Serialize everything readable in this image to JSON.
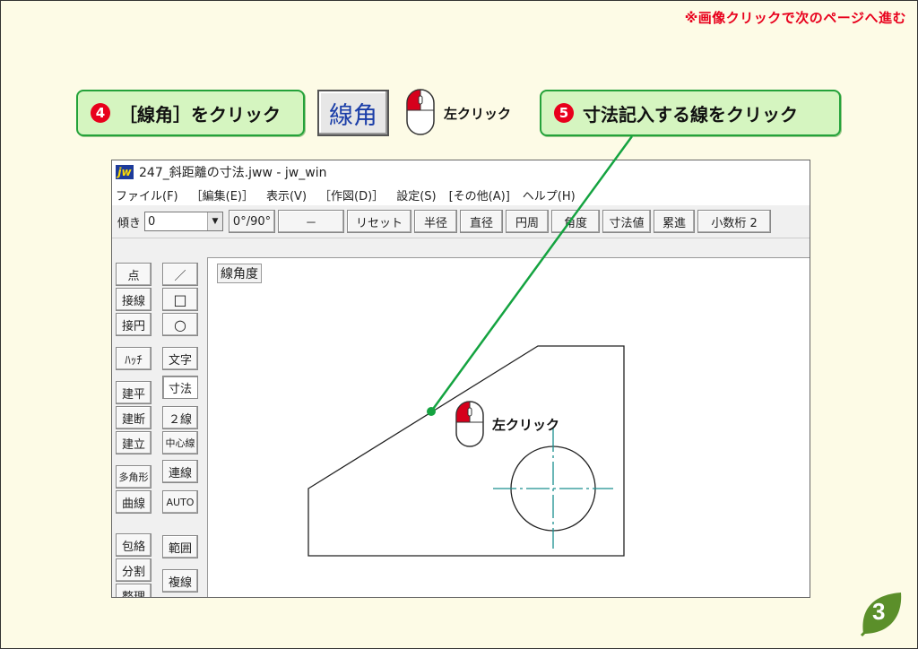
{
  "top_note": "※画像クリックで次のページへ進む",
  "step4": {
    "num": "4",
    "text": "［線角］をクリック"
  },
  "big_button_label": "線角",
  "left_click_1": "左クリック",
  "step5": {
    "num": "5",
    "text": "寸法記入する線をクリック"
  },
  "left_click_2": "左クリック",
  "window": {
    "title": "247_斜距離の寸法.jww - jw_win",
    "logo": "jw",
    "menu": [
      "ファイル(F)",
      "［編集(E)］",
      "表示(V)",
      "［作図(D)］",
      "設定(S)",
      "[その他(A)]",
      "ヘルプ(H)"
    ],
    "toolbar": {
      "tilt_label": "傾き",
      "tilt_value": "0",
      "buttons": [
        "0°/90°",
        "－",
        "リセット",
        "半径",
        "直径",
        "円周",
        "角度",
        "寸法値",
        "累進",
        "小数桁 2"
      ]
    },
    "left_col_1": [
      "点",
      "接線",
      "接円",
      "ﾊｯﾁ",
      "建平",
      "建断",
      "建立",
      "多角形",
      "曲線",
      "包絡",
      "分割",
      "整理"
    ],
    "left_col_2": [
      "／",
      "□",
      "○",
      "文字",
      "寸法",
      "２線",
      "中心線",
      "連線",
      "AUTO",
      "範囲",
      "複線"
    ],
    "canvas_status": "線角度"
  },
  "page_number": "3",
  "colors": {
    "accent_red": "#e8001c",
    "callout_green": "#24a23a",
    "callout_fill": "#d5f5c0",
    "pointer_line": "#14a340",
    "badge_green": "#5b8f2a"
  }
}
